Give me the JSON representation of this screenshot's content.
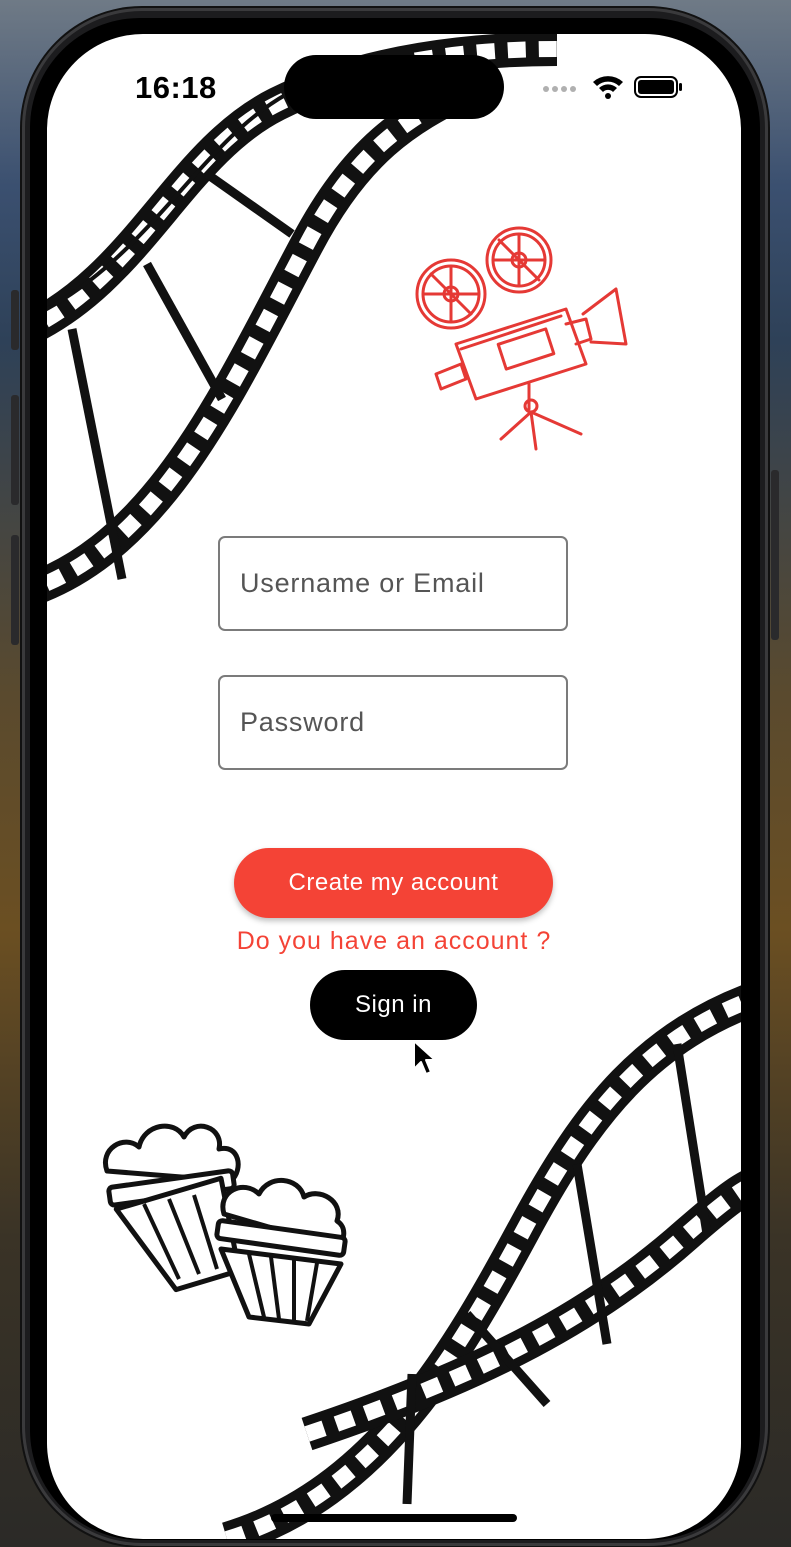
{
  "status_bar": {
    "time": "16:18",
    "icons": [
      "cellular-dots-icon",
      "wifi-icon",
      "battery-icon"
    ]
  },
  "illustrations": {
    "top_film": "film-strip-icon",
    "camera": "movie-projector-camera-icon",
    "popcorn": "popcorn-buckets-icon",
    "bottom_film": "film-strip-icon"
  },
  "form": {
    "username_placeholder": "Username or Email",
    "password_placeholder": "Password",
    "create_label": "Create my account",
    "question": "Do you have an account ?",
    "signin_label": "Sign in"
  },
  "colors": {
    "accent": "#f44336",
    "button_dark": "#000000",
    "background": "#ffffff"
  }
}
